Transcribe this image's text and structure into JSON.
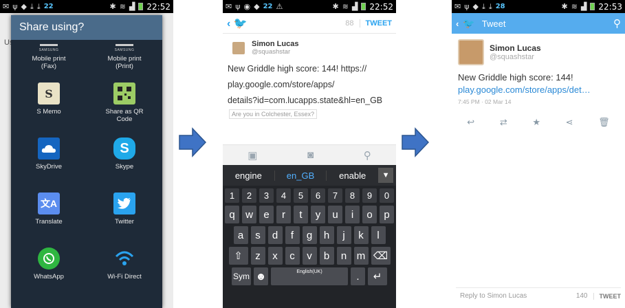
{
  "colors": {
    "twitter_blue": "#55acee",
    "link_blue": "#2a89d6",
    "dialog_header": "#4a6b8a",
    "arrow": "#3f73c5"
  },
  "status": {
    "left_count_1": "22",
    "left_count_2": "22",
    "left_count_3": "28",
    "time_1": "22:52",
    "time_2": "22:52",
    "time_3": "22:53"
  },
  "share": {
    "title": "Share using?",
    "bg_text": "Us",
    "items": [
      {
        "label": "Mobile print (Fax)",
        "icon": "samsung-print-icon"
      },
      {
        "label": "Mobile print (Print)",
        "icon": "samsung-print-icon"
      },
      {
        "label": "S Memo",
        "icon": "s-memo-icon"
      },
      {
        "label": "Share as QR Code",
        "icon": "qr-code-icon"
      },
      {
        "label": "SkyDrive",
        "icon": "skydrive-icon"
      },
      {
        "label": "Skype",
        "icon": "skype-icon"
      },
      {
        "label": "Translate",
        "icon": "translate-icon"
      },
      {
        "label": "Twitter",
        "icon": "twitter-icon"
      },
      {
        "label": "WhatsApp",
        "icon": "whatsapp-icon"
      },
      {
        "label": "Wi-Fi Direct",
        "icon": "wifi-direct-icon"
      }
    ],
    "samsung_label": "SAMSUNG"
  },
  "compose": {
    "char_count": "88",
    "tweet_label": "TWEET",
    "user_name": "Simon Lucas",
    "user_handle": "@squashstar",
    "text_line1": "New Griddle high score: 144! https://",
    "text_line2": "play.google.com/store/apps/",
    "text_line3": "details?id=com.lucapps.state&hl=en_GB",
    "location_prompt": "Are you in Colchester, Essex?",
    "suggestions": [
      "engine",
      "en_GB",
      "enable"
    ],
    "number_row": [
      "1",
      "2",
      "3",
      "4",
      "5",
      "6",
      "7",
      "8",
      "9",
      "0"
    ],
    "row1": [
      "q",
      "w",
      "e",
      "r",
      "t",
      "y",
      "u",
      "i",
      "o",
      "p"
    ],
    "row2": [
      "a",
      "s",
      "d",
      "f",
      "g",
      "h",
      "j",
      "k",
      "l"
    ],
    "row3": [
      "z",
      "x",
      "c",
      "v",
      "b",
      "n",
      "m"
    ],
    "sym_label": "Sym",
    "space_label": "English(UK)",
    "period_label": "."
  },
  "tweet": {
    "header_title": "Tweet",
    "user_name": "Simon Lucas",
    "user_handle": "@squashstar",
    "text": "New Griddle high score: 144!",
    "link": "play.google.com/store/apps/det…",
    "timestamp": "7:45 PM · 02 Mar 14",
    "reply_placeholder": "Reply to Simon Lucas",
    "reply_count": "140",
    "reply_tweet_label": "TWEET"
  }
}
